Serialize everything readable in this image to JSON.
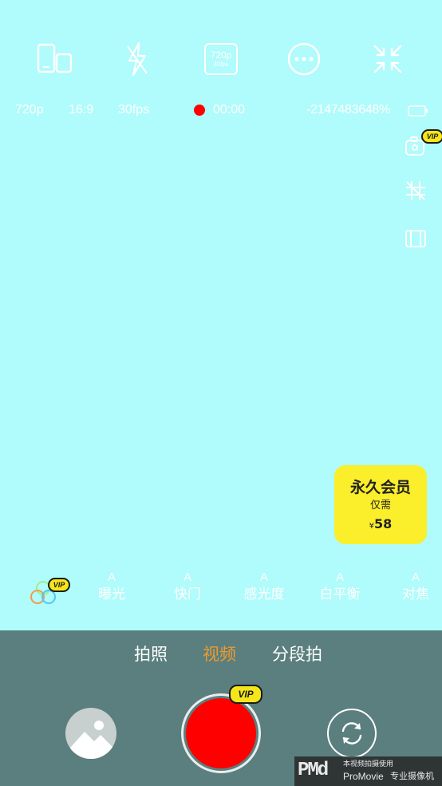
{
  "top_bar": {
    "resolution_icon_text": "720p",
    "resolution_icon_subtext": "30fps"
  },
  "status_bar": {
    "resolution": "720p",
    "aspect_ratio": "16:9",
    "framerate": "30fps",
    "record_time": "00:00",
    "battery": "-2147483648%"
  },
  "vip_label": "VIP",
  "promo": {
    "title": "永久会员",
    "subtitle": "仅需",
    "currency": "¥",
    "price": "58"
  },
  "params": [
    {
      "mode": "A",
      "label": "曝光"
    },
    {
      "mode": "A",
      "label": "快门"
    },
    {
      "mode": "A",
      "label": "感光度"
    },
    {
      "mode": "A",
      "label": "白平衡"
    },
    {
      "mode": "A",
      "label": "对焦"
    }
  ],
  "modes": {
    "photo": "拍照",
    "video": "视频",
    "segment": "分段拍",
    "active": "video"
  },
  "watermark": {
    "logo": "PMd",
    "line1": "本视频拍摄使用",
    "app_name": "ProMovie",
    "app_desc": "专业摄像机"
  },
  "colors": {
    "background": "#b0fbfb",
    "bottom_panel": "#5a7f7e",
    "active_mode": "#f09a2c",
    "record": "#ff0000",
    "vip_yellow": "#f5e61b",
    "promo_yellow": "#fbee2b"
  }
}
